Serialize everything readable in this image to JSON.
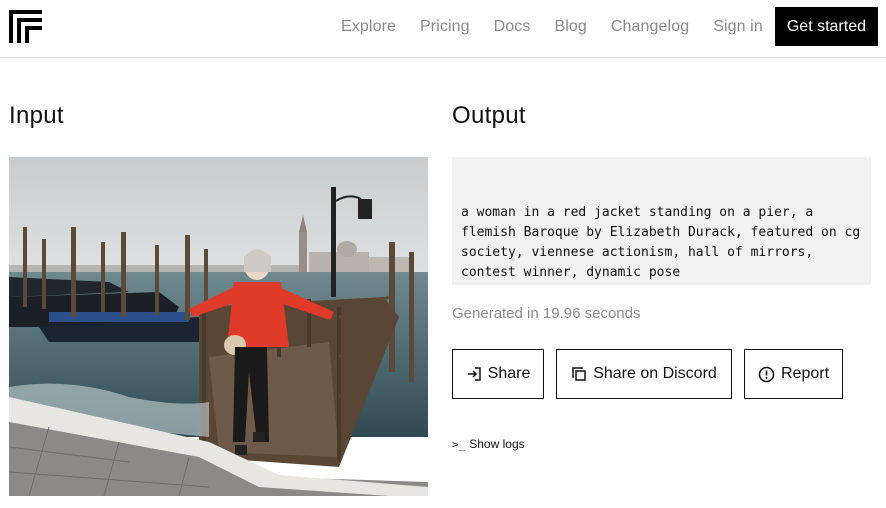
{
  "header": {
    "logo_icon": "replicate-logo-icon",
    "nav": [
      "Explore",
      "Pricing",
      "Docs",
      "Blog",
      "Changelog",
      "Sign in"
    ],
    "cta_label": "Get started"
  },
  "input": {
    "title": "Input",
    "image_icon": "photo-woman-on-venice-pier"
  },
  "output": {
    "title": "Output",
    "caption": "a woman in a red jacket standing on a pier, a flemish Baroque by Elizabeth Durack, featured on cg society, viennese actionism, hall of mirrors, contest winner, dynamic pose",
    "generated_text": "Generated in 19.96 seconds",
    "buttons": {
      "share": "Share",
      "discord": "Share on Discord",
      "report": "Report"
    },
    "show_logs": "Show logs",
    "show_logs_prompt": ">_"
  },
  "colors": {
    "accent": "#000000",
    "muted_text": "#8a8a8a",
    "output_bg": "#f1f1f1"
  }
}
